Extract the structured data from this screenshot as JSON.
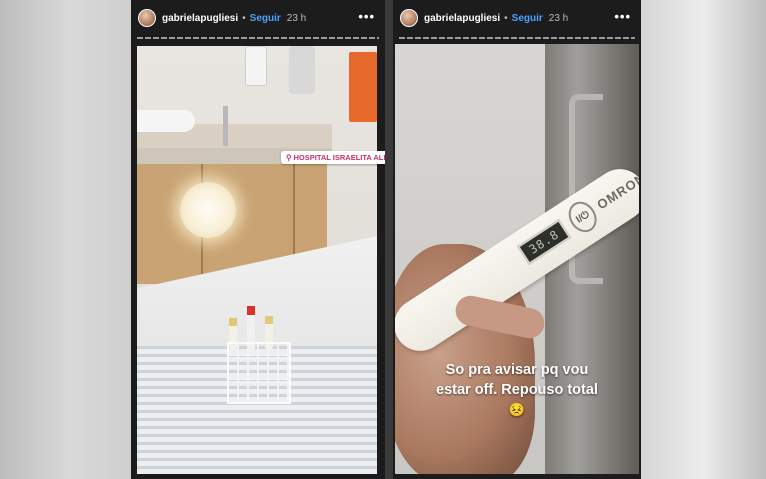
{
  "stories": [
    {
      "username": "gabrielapugliesi",
      "separator": "•",
      "follow_label": "Seguir",
      "time": "23 h",
      "more": "•••",
      "location_tag": "HOSPITAL ISRAELITA ALBERT EINSTEIN"
    },
    {
      "username": "gabrielapugliesi",
      "separator": "•",
      "follow_label": "Seguir",
      "time": "23 h",
      "more": "•••",
      "thermometer": {
        "display": "38.8",
        "button": "I/⏻",
        "brand": "OMRON"
      },
      "caption_lines": [
        "So pra avisar pq vou",
        "estar off. Repouso total"
      ],
      "caption_emoji": "😣"
    }
  ],
  "colors": {
    "follow": "#4aa3ff",
    "location_tag_text": "#c4306b"
  }
}
